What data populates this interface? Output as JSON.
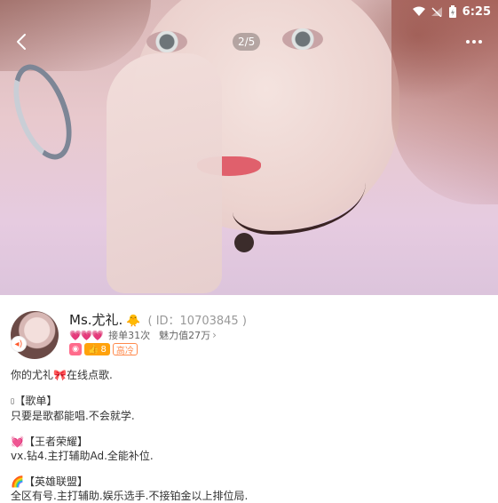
{
  "status_bar": {
    "time": "6:25"
  },
  "photo_viewer": {
    "counter": "2/5"
  },
  "profile": {
    "name": "Ms.尤礼.",
    "name_emoji": "🐥",
    "user_id": "( ID：10703845 )",
    "hearts": "💗💗💗",
    "orders": "接单31次",
    "charm": "魅力值27万",
    "level": "8",
    "tag": "高冷"
  },
  "bio": {
    "line1_prefix": "你的尤礼",
    "line1_emoji": "🎀",
    "line1_suffix": "在线点歌.",
    "song_heading": "【歌单】",
    "song_text": "只要是歌都能唱.不会就学.",
    "wz_emoji": "💓",
    "wz_heading": "【王者荣耀】",
    "wz_text": "vx.钻4.主打辅助Ad.全能补位.",
    "lol_emoji": "🌈",
    "lol_heading": "【英雄联盟】",
    "lol_text": "全区有号.主打辅助.娱乐选手.不接铂金以上排位局."
  },
  "colors": {
    "accent_orange": "#ffa20c",
    "tag_orange": "#ff8a4c",
    "heart_pink": "#ff7aa7"
  }
}
